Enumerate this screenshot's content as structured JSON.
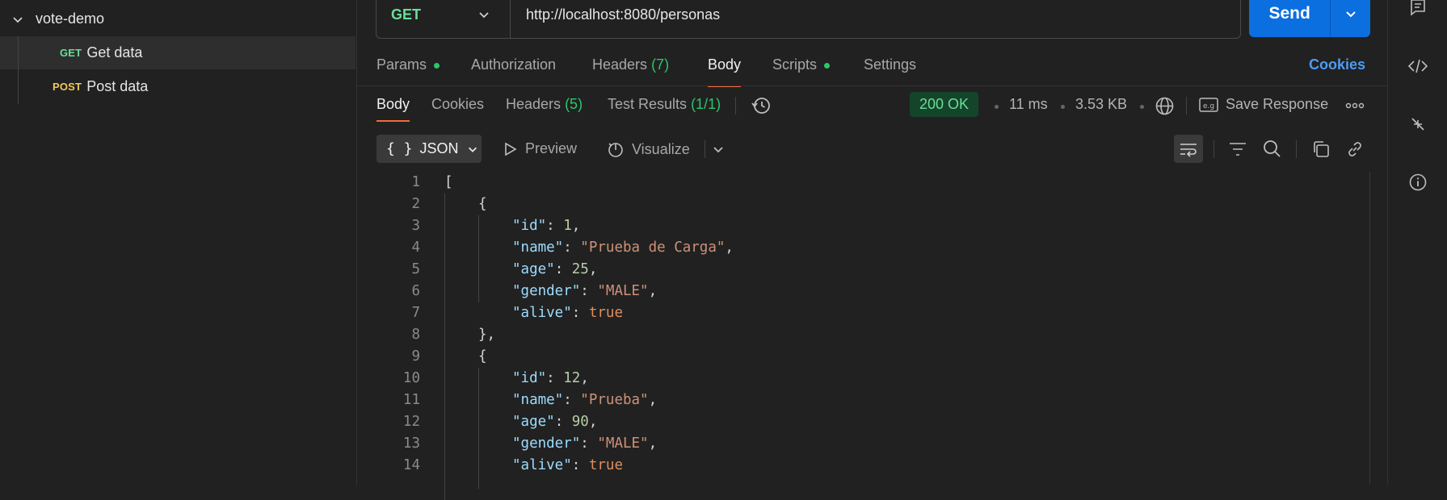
{
  "sidebar": {
    "collection": "vote-demo",
    "items": [
      {
        "method": "GET",
        "label": "Get data"
      },
      {
        "method": "POST",
        "label": "Post data"
      }
    ]
  },
  "request": {
    "method": "GET",
    "url": "http://localhost:8080/personas",
    "send_label": "Send"
  },
  "request_tabs": {
    "params": "Params",
    "authorization": "Authorization",
    "headers": "Headers",
    "headers_count": "(7)",
    "body": "Body",
    "scripts": "Scripts",
    "settings": "Settings",
    "cookies": "Cookies"
  },
  "response_tabs": {
    "body": "Body",
    "cookies": "Cookies",
    "headers": "Headers",
    "headers_count": "(5)",
    "test_results": "Test Results",
    "test_results_count": "(1/1)"
  },
  "response_meta": {
    "status": "200 OK",
    "time": "11 ms",
    "size": "3.53 KB",
    "save_response": "Save Response"
  },
  "toolbar": {
    "format": "JSON",
    "preview": "Preview",
    "visualize": "Visualize"
  },
  "code": {
    "line_numbers": [
      "1",
      "2",
      "3",
      "4",
      "5",
      "6",
      "7",
      "8",
      "9",
      "10",
      "11",
      "12",
      "13",
      "14"
    ],
    "l1": "[",
    "l2": "{",
    "l3k": "\"id\"",
    "l3v": "1",
    "l4k": "\"name\"",
    "l4v": "\"Prueba de Carga\"",
    "l5k": "\"age\"",
    "l5v": "25",
    "l6k": "\"gender\"",
    "l6v": "\"MALE\"",
    "l7k": "\"alive\"",
    "l7v": "true",
    "l8": "},",
    "l9": "{",
    "l10k": "\"id\"",
    "l10v": "12",
    "l11k": "\"name\"",
    "l11v": "\"Prueba\"",
    "l12k": "\"age\"",
    "l12v": "90",
    "l13k": "\"gender\"",
    "l13v": "\"MALE\"",
    "l14k": "\"alive\"",
    "l14v": "true"
  },
  "colors": {
    "accent_tab": "#f26b3a",
    "send_button": "#0b6fe0",
    "status_ok": "#6bdd9a",
    "link": "#4c9cf5"
  }
}
